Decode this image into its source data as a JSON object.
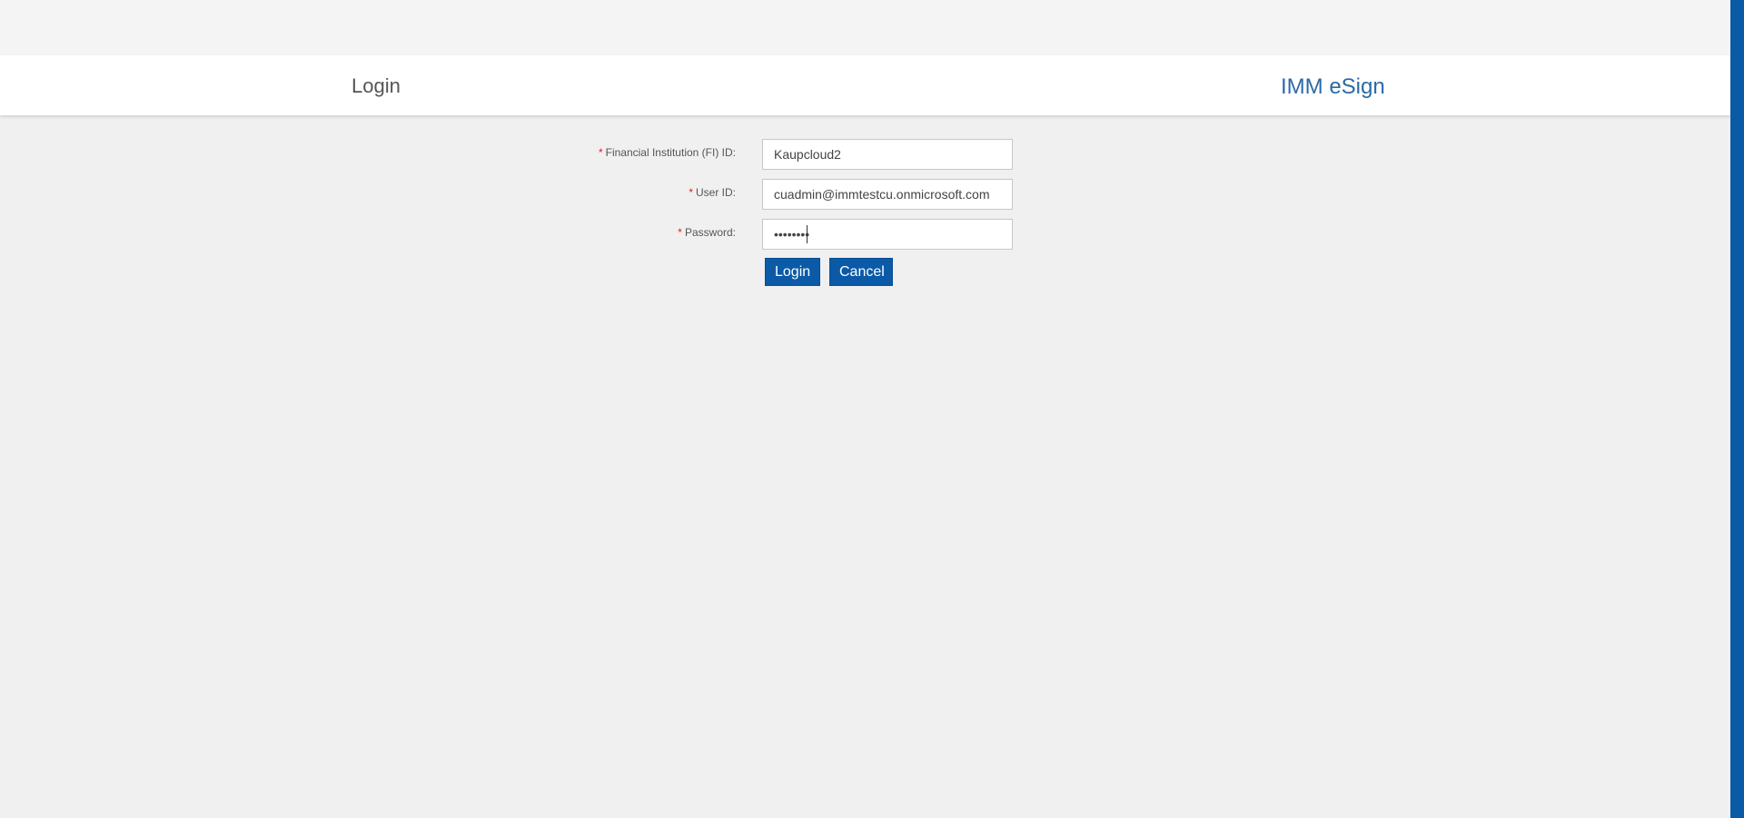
{
  "header": {
    "page_title": "Login",
    "brand": "IMM eSign"
  },
  "form": {
    "fi_id": {
      "label": "Financial Institution (FI) ID:",
      "value": "Kaupcloud2"
    },
    "user_id": {
      "label": "User ID:",
      "value": "cuadmin@immtestcu.onmicrosoft.com"
    },
    "password": {
      "label": "Password:",
      "value": "••••••••"
    },
    "required_marker": "*",
    "login_label": "Login",
    "cancel_label": "Cancel"
  },
  "colors": {
    "accent": "#0b5aa8",
    "brand_text": "#2b6aa5",
    "required": "#d0232b",
    "background": "#f0f0f0"
  }
}
